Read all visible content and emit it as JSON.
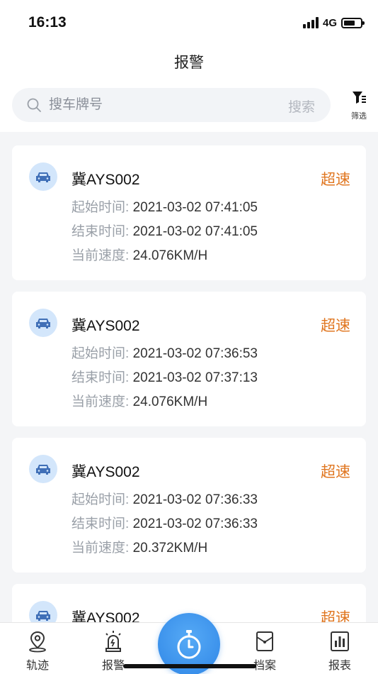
{
  "status_bar": {
    "time": "16:13",
    "network": "4G"
  },
  "header": {
    "title": "报警"
  },
  "search": {
    "placeholder": "搜车牌号",
    "button_label": "搜索"
  },
  "filter": {
    "label": "筛选",
    "icon": "filter-icon"
  },
  "alarms": [
    {
      "plate": "冀AYS002",
      "type": "超速",
      "start_label": "起始时间:",
      "start_time": "2021-03-02 07:41:05",
      "end_label": "结束时间:",
      "end_time": "2021-03-02 07:41:05",
      "speed_label": "当前速度:",
      "speed": "24.076KM/H"
    },
    {
      "plate": "冀AYS002",
      "type": "超速",
      "start_label": "起始时间:",
      "start_time": "2021-03-02 07:36:53",
      "end_label": "结束时间:",
      "end_time": "2021-03-02 07:37:13",
      "speed_label": "当前速度:",
      "speed": "24.076KM/H"
    },
    {
      "plate": "冀AYS002",
      "type": "超速",
      "start_label": "起始时间:",
      "start_time": "2021-03-02 07:36:33",
      "end_label": "结束时间:",
      "end_time": "2021-03-02 07:36:33",
      "speed_label": "当前速度:",
      "speed": "20.372KM/H"
    },
    {
      "plate": "冀AYS002",
      "type": "超速"
    }
  ],
  "tabbar": {
    "tabs": [
      {
        "label": "轨迹",
        "icon": "location-pin-icon"
      },
      {
        "label": "报警",
        "icon": "alarm-light-icon"
      },
      {
        "label": "档案",
        "icon": "archive-icon"
      },
      {
        "label": "报表",
        "icon": "bar-chart-icon"
      }
    ],
    "center_icon": "stopwatch-icon"
  },
  "colors": {
    "accent": "#2f86e6",
    "alarm": "#e07620",
    "avatar_bg": "#d3e6fb"
  }
}
